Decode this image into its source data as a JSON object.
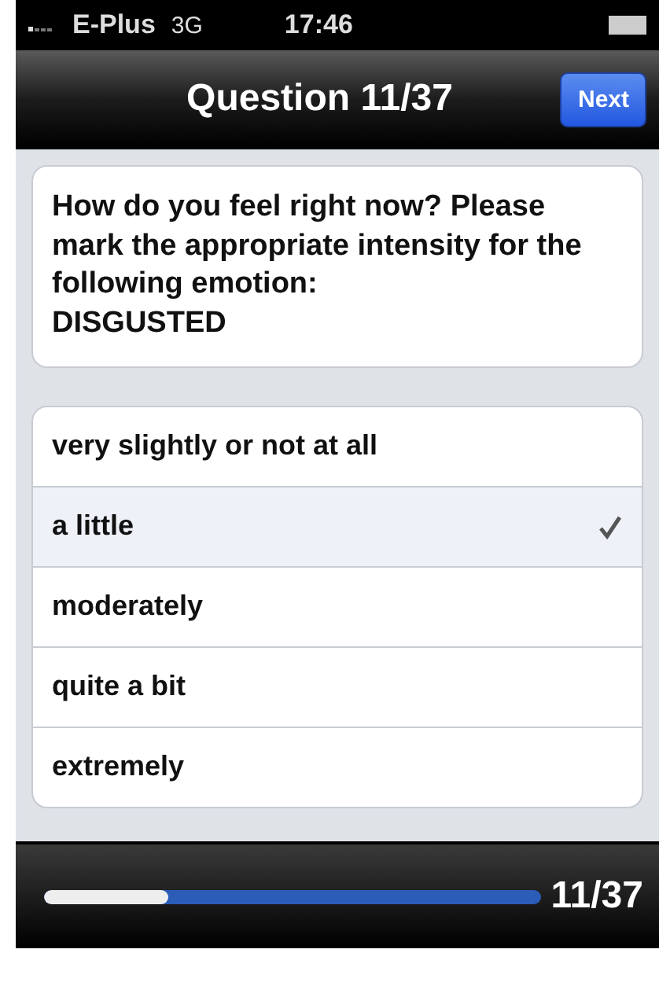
{
  "status_bar": {
    "carrier": "E-Plus",
    "network": "3G",
    "time": "17:46"
  },
  "nav_bar": {
    "title": "Question 11/37",
    "next_button": "Next"
  },
  "question": {
    "prompt": "How do you feel right now? Please mark the appropriate intensity for the following emotion:",
    "emotion": "DISGUSTED"
  },
  "options": [
    {
      "label": "very slightly or not at all",
      "selected": false
    },
    {
      "label": "a little",
      "selected": true
    },
    {
      "label": "moderately",
      "selected": false
    },
    {
      "label": "quite a bit",
      "selected": false
    },
    {
      "label": "extremely",
      "selected": false
    }
  ],
  "progress": {
    "level": 0.25,
    "reading": "11/37"
  }
}
